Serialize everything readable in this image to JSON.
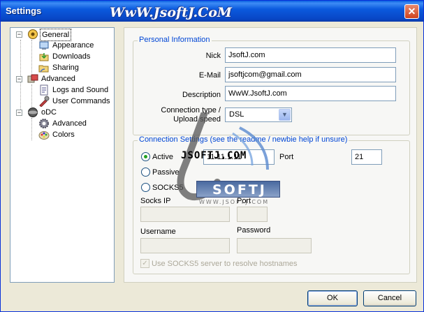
{
  "window": {
    "title": "Settings",
    "watermark": "WwW.JsoftJ.CoM",
    "close_glyph": "✕"
  },
  "tree": {
    "items": [
      {
        "label": "General",
        "icon": "general-icon",
        "expand": "−"
      },
      {
        "label": "Appearance",
        "icon": "appearance-icon"
      },
      {
        "label": "Downloads",
        "icon": "downloads-icon"
      },
      {
        "label": "Sharing",
        "icon": "sharing-icon"
      },
      {
        "label": "Advanced",
        "icon": "advanced-icon",
        "expand": "−"
      },
      {
        "label": "Logs and Sound",
        "icon": "logs-icon"
      },
      {
        "label": "User Commands",
        "icon": "user-commands-icon"
      },
      {
        "label": "oDC",
        "icon": "odc-icon",
        "expand": "−"
      },
      {
        "label": "Advanced",
        "icon": "gear-icon"
      },
      {
        "label": "Colors",
        "icon": "colors-icon"
      }
    ]
  },
  "personal": {
    "legend": "Personal Information",
    "nick_label": "Nick",
    "nick_value": "JsoftJ.com",
    "email_label": "E-Mail",
    "email_value": "jsoftjcom@gmail.com",
    "desc_label": "Description",
    "desc_value": "WwW.JsoftJ.com",
    "conn_label_1": "Connection type /",
    "conn_label_2": "Upload speed",
    "conn_value": "DSL"
  },
  "connection": {
    "legend": "Connection Settings (see the readme / newbie help if unsure)",
    "active_label": "Active",
    "ip_value": "11.11.1.11",
    "port_label": "Port",
    "port_value": "21",
    "passive_label": "Passive",
    "socks5_label": "SOCKS5",
    "socks_ip_label": "Socks IP",
    "socks_port_label": "Port",
    "username_label": "Username",
    "password_label": "Password",
    "resolve_label": "Use SOCKS5 server to resolve hostnames"
  },
  "overlay": {
    "big": "JSOFTJ.COM",
    "logo": "SOFTJ",
    "logo_sub": "WWW.JSOFTJ.COM"
  },
  "buttons": {
    "ok": "OK",
    "cancel": "Cancel"
  },
  "colors": {
    "title_bar": "#0b5ade",
    "legend_text": "#0046d5",
    "radio_dot": "#21a121"
  }
}
